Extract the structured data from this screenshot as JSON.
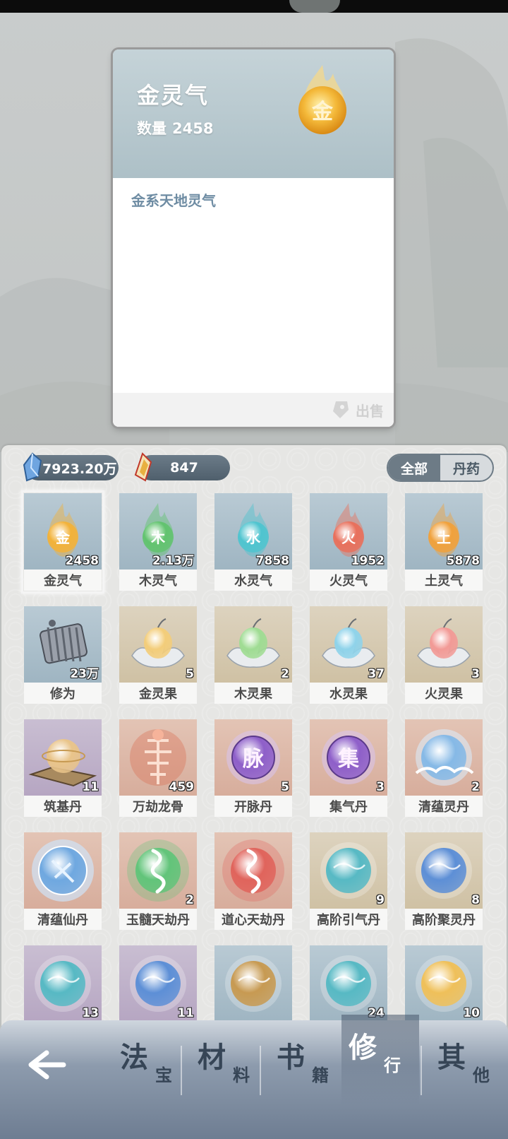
{
  "detail": {
    "name": "金灵气",
    "qty_label": "数量",
    "qty_value": "2458",
    "icon": "gold-spirit-orb-icon",
    "icon_glyph": "金",
    "description": "金系天地灵气",
    "sell_label": "出售"
  },
  "currency": {
    "spirit_stone": "7923.20万",
    "jade": "847"
  },
  "filters": [
    {
      "label": "全部",
      "active": true
    },
    {
      "label": "丹药",
      "active": false
    }
  ],
  "items": [
    {
      "name": "金灵气",
      "count": "2458",
      "bg": "blue",
      "art": "orb",
      "color": "#f2b23a",
      "glyph": "金"
    },
    {
      "name": "木灵气",
      "count": "2.13万",
      "bg": "blue",
      "art": "orb",
      "color": "#62c36f",
      "glyph": "木"
    },
    {
      "name": "水灵气",
      "count": "7858",
      "bg": "blue",
      "art": "orb",
      "color": "#4fc4cf",
      "glyph": "水"
    },
    {
      "name": "火灵气",
      "count": "1952",
      "bg": "blue",
      "art": "orb",
      "color": "#e8705c",
      "glyph": "火"
    },
    {
      "name": "土灵气",
      "count": "5878",
      "bg": "blue",
      "art": "orb",
      "color": "#f0a13c",
      "glyph": "土"
    },
    {
      "name": "修为",
      "count": "23万",
      "bg": "blue",
      "art": "scroll",
      "color": "#8a8f98"
    },
    {
      "name": "金灵果",
      "count": "5",
      "bg": "tan",
      "art": "fruit",
      "color": "#f3cd7a"
    },
    {
      "name": "木灵果",
      "count": "2",
      "bg": "tan",
      "art": "fruit",
      "color": "#9fdc93"
    },
    {
      "name": "水灵果",
      "count": "37",
      "bg": "tan",
      "art": "fruit",
      "color": "#8fd3ea"
    },
    {
      "name": "火灵果",
      "count": "3",
      "bg": "tan",
      "art": "fruit",
      "color": "#f29a96"
    },
    {
      "name": "筑基丹",
      "count": "11",
      "bg": "purple",
      "art": "pill-stand",
      "color": "#e9c48a"
    },
    {
      "name": "万劫龙骨",
      "count": "459",
      "bg": "peach",
      "art": "bone",
      "color": "#d96a4e"
    },
    {
      "name": "开脉丹",
      "count": "5",
      "bg": "peach",
      "art": "glyph-orb",
      "color": "#8e5fc9",
      "glyph": "脉"
    },
    {
      "name": "集气丹",
      "count": "3",
      "bg": "peach",
      "art": "glyph-orb",
      "color": "#8e5fc9",
      "glyph": "集"
    },
    {
      "name": "清蕴灵丹",
      "count": "2",
      "bg": "peach",
      "art": "cloud-orb",
      "color": "#86b9e6"
    },
    {
      "name": "清蕴仙丹",
      "count": "",
      "bg": "peach",
      "art": "seal-orb",
      "color": "#6fa8e0"
    },
    {
      "name": "玉髓天劫丹",
      "count": "2",
      "bg": "peach",
      "art": "dragon-orb",
      "color": "#62c47a"
    },
    {
      "name": "道心天劫丹",
      "count": "",
      "bg": "peach",
      "art": "dragon-orb",
      "color": "#e0645c"
    },
    {
      "name": "高阶引气丹",
      "count": "9",
      "bg": "tan",
      "art": "pill",
      "color": "#57b9c4"
    },
    {
      "name": "高阶聚灵丹",
      "count": "8",
      "bg": "tan",
      "art": "pill",
      "color": "#5d8fd6"
    },
    {
      "name": "",
      "count": "13",
      "bg": "purple",
      "art": "pill",
      "color": "#57b9c4"
    },
    {
      "name": "",
      "count": "11",
      "bg": "purple",
      "art": "pill",
      "color": "#5d8fd6"
    },
    {
      "name": "",
      "count": "",
      "bg": "blue",
      "art": "pill",
      "color": "#c79a52"
    },
    {
      "name": "",
      "count": "24",
      "bg": "blue",
      "art": "pill",
      "color": "#57b9c4"
    },
    {
      "name": "",
      "count": "10",
      "bg": "blue",
      "art": "pill",
      "color": "#efc05a"
    }
  ],
  "nav": {
    "back_icon": "back-arrow-icon",
    "tabs": [
      {
        "main": "法",
        "sub": "宝",
        "active": false
      },
      {
        "main": "材",
        "sub": "料",
        "active": false
      },
      {
        "main": "书",
        "sub": "籍",
        "active": false
      },
      {
        "main": "修",
        "sub": "行",
        "active": true
      },
      {
        "main": "其",
        "sub": "他",
        "active": false
      }
    ]
  }
}
